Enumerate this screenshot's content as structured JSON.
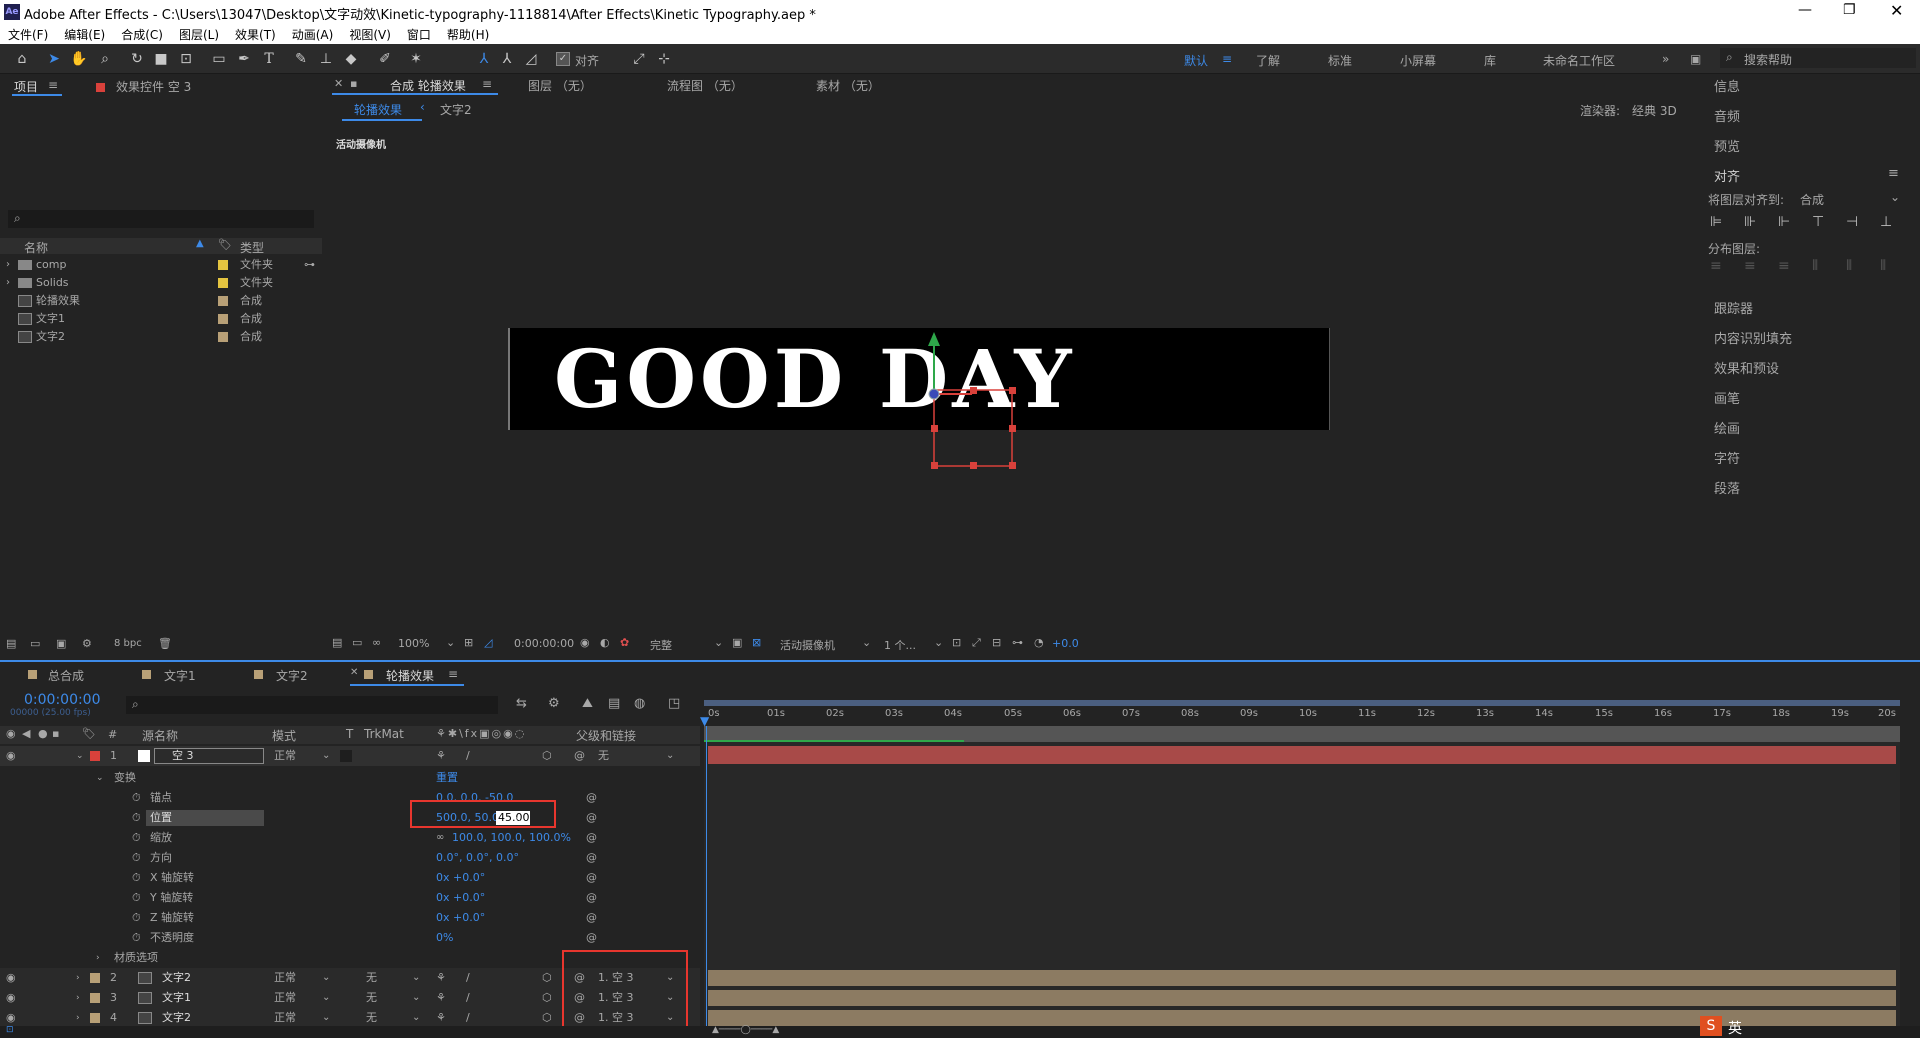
{
  "window": {
    "title": "Adobe After Effects - C:\\Users\\13047\\Desktop\\文字动效\\Kinetic-typography-1118814\\After Effects\\Kinetic Typography.aep *"
  },
  "menu": [
    "文件(F)",
    "编辑(E)",
    "合成(C)",
    "图层(L)",
    "效果(T)",
    "动画(A)",
    "视图(V)",
    "窗口",
    "帮助(H)"
  ],
  "toolbar": {
    "snap_label": "对齐",
    "workspaces": [
      "默认",
      "了解",
      "标准",
      "小屏幕",
      "库",
      "未命名工作区"
    ],
    "search_placeholder": "搜索帮助"
  },
  "project": {
    "tab_project": "项目",
    "tab_effects": "效果控件 空 3",
    "col_name": "名称",
    "col_type": "类型",
    "items": [
      {
        "name": "comp",
        "type": "文件夹"
      },
      {
        "name": "Solids",
        "type": "文件夹"
      },
      {
        "name": "轮播效果",
        "type": "合成"
      },
      {
        "name": "文字1",
        "type": "合成"
      },
      {
        "name": "文字2",
        "type": "合成"
      }
    ],
    "bpc": "8 bpc"
  },
  "comp_viewer": {
    "tab_comp": "合成 轮播效果",
    "tab_layer": "图层 （无）",
    "tab_flow": "流程图 （无）",
    "tab_footage": "素材 （无）",
    "breadcrumb_active": "轮播效果",
    "breadcrumb_next": "文字2",
    "renderer_label": "渲染器:",
    "renderer_value": "经典 3D",
    "camera_label": "活动摄像机",
    "canvas_text": "GOOD DAY",
    "zoom": "100%",
    "timecode": "0:00:00:00",
    "quality": "完整",
    "view": "活动摄像机",
    "views_count": "1 个...",
    "exposure": "+0.0"
  },
  "right_panel": {
    "items_top": [
      "信息",
      "音频",
      "预览"
    ],
    "align_title": "对齐",
    "align_to_label": "将图层对齐到:",
    "align_to_value": "合成",
    "distribute_label": "分布图层:",
    "items_bottom": [
      "跟踪器",
      "内容识别填充",
      "效果和预设",
      "画笔",
      "绘画",
      "字符",
      "段落"
    ]
  },
  "timeline": {
    "tabs": [
      "总合成",
      "文字1",
      "文字2",
      "轮播效果"
    ],
    "timecode": "0:00:00:00",
    "fps": "00000 (25.00 fps)",
    "columns": {
      "source": "源名称",
      "mode": "模式",
      "t": "T",
      "trkmat": "TrkMat",
      "parent": "父级和链接"
    },
    "ruler": [
      "0s",
      "01s",
      "02s",
      "03s",
      "04s",
      "05s",
      "06s",
      "07s",
      "08s",
      "09s",
      "10s",
      "11s",
      "12s",
      "13s",
      "14s",
      "15s",
      "16s",
      "17s",
      "18s",
      "19s",
      "20s"
    ],
    "layer1": {
      "num": "1",
      "name": "空 3",
      "mode": "正常",
      "parent": "无"
    },
    "transform_label": "变换",
    "reset_label": "重置",
    "props": [
      {
        "name": "锚点",
        "value": "0.0, 0.0, -50.0"
      },
      {
        "name": "位置",
        "value": "500.0, 50.0,",
        "edit": "45.00"
      },
      {
        "name": "缩放",
        "value": "100.0, 100.0, 100.0%"
      },
      {
        "name": "方向",
        "value": "0.0°, 0.0°, 0.0°"
      },
      {
        "name": "X 轴旋转",
        "value": "0x +0.0°"
      },
      {
        "name": "Y 轴旋转",
        "value": "0x +0.0°"
      },
      {
        "name": "Z 轴旋转",
        "value": "0x +0.0°"
      },
      {
        "name": "不透明度",
        "value": "0%"
      }
    ],
    "material_label": "材质选项",
    "layers": [
      {
        "num": "2",
        "name": "文字2",
        "mode": "正常",
        "trkmat": "无",
        "parent": "1. 空 3"
      },
      {
        "num": "3",
        "name": "文字1",
        "mode": "正常",
        "trkmat": "无",
        "parent": "1. 空 3"
      },
      {
        "num": "4",
        "name": "文字2",
        "mode": "正常",
        "trkmat": "无",
        "parent": "1. 空 3"
      }
    ]
  },
  "taskbar": {
    "ime": "英"
  }
}
